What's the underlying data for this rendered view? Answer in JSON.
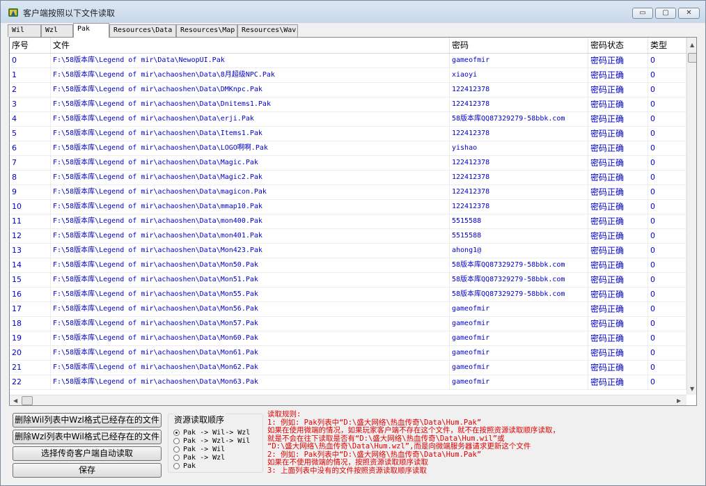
{
  "window": {
    "title": "客户端按照以下文件读取",
    "controls": {
      "minimize": "▭",
      "maximize": "▢",
      "close": "✕"
    }
  },
  "tabs": [
    {
      "label": "Wil",
      "active": false
    },
    {
      "label": "Wzl",
      "active": false
    },
    {
      "label": "Pak",
      "active": true
    },
    {
      "label": "Resources\\Data",
      "active": false
    },
    {
      "label": "Resources\\Map",
      "active": false
    },
    {
      "label": "Resources\\Wav",
      "active": false
    }
  ],
  "table": {
    "columns": [
      "序号",
      "文件",
      "密码",
      "密码状态",
      "类型"
    ],
    "rows": [
      {
        "index": "0",
        "file": "F:\\58版本库\\Legend of mir\\Data\\NewopUI.Pak",
        "password": "gameofmir",
        "status": "密码正确",
        "type": "0"
      },
      {
        "index": "1",
        "file": "F:\\58版本库\\Legend of mir\\achaoshen\\Data\\8月超级NPC.Pak",
        "password": "xiaoyi",
        "status": "密码正确",
        "type": "0"
      },
      {
        "index": "2",
        "file": "F:\\58版本库\\Legend of mir\\achaoshen\\Data\\DMKnpc.Pak",
        "password": "122412378",
        "status": "密码正确",
        "type": "0"
      },
      {
        "index": "3",
        "file": "F:\\58版本库\\Legend of mir\\achaoshen\\Data\\Dnitems1.Pak",
        "password": "122412378",
        "status": "密码正确",
        "type": "0"
      },
      {
        "index": "4",
        "file": "F:\\58版本库\\Legend of mir\\achaoshen\\Data\\erji.Pak",
        "password": "58版本库QQ87329279-58bbk.com",
        "status": "密码正确",
        "type": "0"
      },
      {
        "index": "5",
        "file": "F:\\58版本库\\Legend of mir\\achaoshen\\Data\\Items1.Pak",
        "password": "122412378",
        "status": "密码正确",
        "type": "0"
      },
      {
        "index": "6",
        "file": "F:\\58版本库\\Legend of mir\\achaoshen\\Data\\LOGO啊啊.Pak",
        "password": "yishao",
        "status": "密码正确",
        "type": "0"
      },
      {
        "index": "7",
        "file": "F:\\58版本库\\Legend of mir\\achaoshen\\Data\\Magic.Pak",
        "password": "122412378",
        "status": "密码正确",
        "type": "0"
      },
      {
        "index": "8",
        "file": "F:\\58版本库\\Legend of mir\\achaoshen\\Data\\Magic2.Pak",
        "password": "122412378",
        "status": "密码正确",
        "type": "0"
      },
      {
        "index": "9",
        "file": "F:\\58版本库\\Legend of mir\\achaoshen\\Data\\magicon.Pak",
        "password": "122412378",
        "status": "密码正确",
        "type": "0"
      },
      {
        "index": "10",
        "file": "F:\\58版本库\\Legend of mir\\achaoshen\\Data\\mmap10.Pak",
        "password": "122412378",
        "status": "密码正确",
        "type": "0"
      },
      {
        "index": "11",
        "file": "F:\\58版本库\\Legend of mir\\achaoshen\\Data\\mon400.Pak",
        "password": "5515588",
        "status": "密码正确",
        "type": "0"
      },
      {
        "index": "12",
        "file": "F:\\58版本库\\Legend of mir\\achaoshen\\Data\\mon401.Pak",
        "password": "5515588",
        "status": "密码正确",
        "type": "0"
      },
      {
        "index": "13",
        "file": "F:\\58版本库\\Legend of mir\\achaoshen\\Data\\Mon423.Pak",
        "password": "ahong1@",
        "status": "密码正确",
        "type": "0"
      },
      {
        "index": "14",
        "file": "F:\\58版本库\\Legend of mir\\achaoshen\\Data\\Mon50.Pak",
        "password": "58版本库QQ87329279-58bbk.com",
        "status": "密码正确",
        "type": "0"
      },
      {
        "index": "15",
        "file": "F:\\58版本库\\Legend of mir\\achaoshen\\Data\\Mon51.Pak",
        "password": "58版本库QQ87329279-58bbk.com",
        "status": "密码正确",
        "type": "0"
      },
      {
        "index": "16",
        "file": "F:\\58版本库\\Legend of mir\\achaoshen\\Data\\Mon55.Pak",
        "password": "58版本库QQ87329279-58bbk.com",
        "status": "密码正确",
        "type": "0"
      },
      {
        "index": "17",
        "file": "F:\\58版本库\\Legend of mir\\achaoshen\\Data\\Mon56.Pak",
        "password": "gameofmir",
        "status": "密码正确",
        "type": "0"
      },
      {
        "index": "18",
        "file": "F:\\58版本库\\Legend of mir\\achaoshen\\Data\\Mon57.Pak",
        "password": "gameofmir",
        "status": "密码正确",
        "type": "0"
      },
      {
        "index": "19",
        "file": "F:\\58版本库\\Legend of mir\\achaoshen\\Data\\Mon60.Pak",
        "password": "gameofmir",
        "status": "密码正确",
        "type": "0"
      },
      {
        "index": "20",
        "file": "F:\\58版本库\\Legend of mir\\achaoshen\\Data\\Mon61.Pak",
        "password": "gameofmir",
        "status": "密码正确",
        "type": "0"
      },
      {
        "index": "21",
        "file": "F:\\58版本库\\Legend of mir\\achaoshen\\Data\\Mon62.Pak",
        "password": "gameofmir",
        "status": "密码正确",
        "type": "0"
      },
      {
        "index": "22",
        "file": "F:\\58版本库\\Legend of mir\\achaoshen\\Data\\Mon63.Pak",
        "password": "gameofmir",
        "status": "密码正确",
        "type": "0"
      }
    ]
  },
  "buttons": {
    "delete_wil": "删除Wil列表中Wzl格式已经存在的文件",
    "delete_wzl": "删除Wzl列表中Wil格式已经存在的文件",
    "auto_read": "选择传奇客户端自动读取",
    "save": "保存"
  },
  "read_order": {
    "title": "资源读取顺序",
    "options": [
      {
        "label": "Pak -> Wil-> Wzl",
        "checked": true
      },
      {
        "label": "Pak -> Wzl-> Wil",
        "checked": false
      },
      {
        "label": "Pak -> Wil",
        "checked": false
      },
      {
        "label": "Pak -> Wzl",
        "checked": false
      },
      {
        "label": "Pak",
        "checked": false
      }
    ]
  },
  "rules": {
    "title": "读取规则:",
    "lines": [
      "1: 例如: Pak列表中“D:\\盛大网络\\热血传奇\\Data\\Hum.Pak”",
      "   如果在使用微端的情况，如果玩家客户端不存在这个文件，就不在按照资源读取顺序读取，",
      "   就是不会在往下读取是否有“D:\\盛大网络\\热血传奇\\Data\\Hum.wil”或",
      "   “D:\\盛大网络\\热血传奇\\Data\\Hum.wzl”,而是向微端服务器请求更新这个文件",
      "2: 例如: Pak列表中“D:\\盛大网络\\热血传奇\\Data\\Hum.Pak”",
      "   如果在不使用微端的情况，按照资源读取顺序读取",
      "3: 上面列表中没有的文件按照资源读取顺序读取"
    ]
  },
  "colors": {
    "row_text": "#0000c8",
    "rules_text": "#e00000"
  },
  "icons": {
    "app": "app-icon",
    "scroll_up": "scroll-up-arrow-icon",
    "scroll_down": "scroll-down-arrow-icon",
    "scroll_left": "scroll-left-arrow-icon",
    "scroll_right": "scroll-right-arrow-icon"
  }
}
